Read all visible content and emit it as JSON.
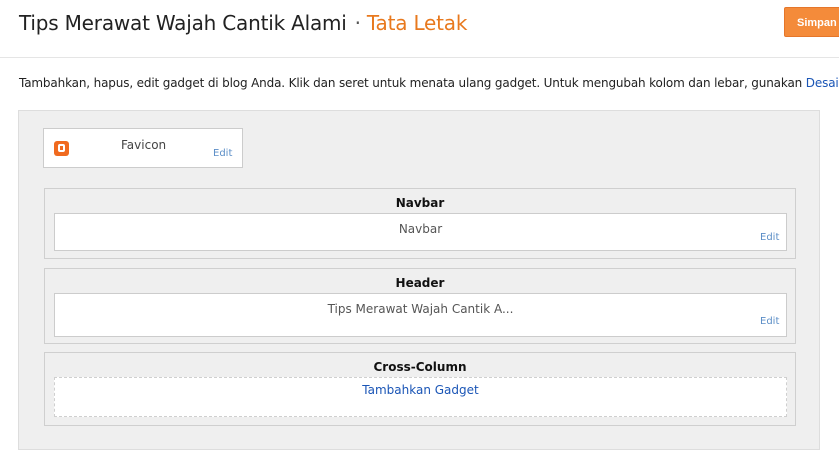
{
  "header": {
    "blog_title": "Tips Merawat Wajah Cantik Alami",
    "separator": "·",
    "page_name": "Tata Letak",
    "save_label": "Simpan"
  },
  "instructions": {
    "text": "Tambahkan, hapus, edit gadget di blog Anda. Klik dan seret untuk menata ulang gadget. Untuk mengubah kolom dan lebar, gunakan ",
    "link": "Desainer"
  },
  "favicon": {
    "icon": "blogger-icon",
    "label": "Favicon",
    "edit": "Edit"
  },
  "sections": {
    "navbar": {
      "title": "Navbar",
      "gadget_label": "Navbar",
      "edit": "Edit"
    },
    "header": {
      "title": "Header",
      "gadget_label": "Tips Merawat Wajah Cantik A...",
      "edit": "Edit"
    },
    "cross_column": {
      "title": "Cross-Column",
      "add_gadget": "Tambahkan Gadget"
    }
  },
  "colors": {
    "accent": "#e8791e",
    "save_button": "#f48b3a",
    "link": "#1a55b6",
    "edit_link": "#5b8ec7"
  }
}
